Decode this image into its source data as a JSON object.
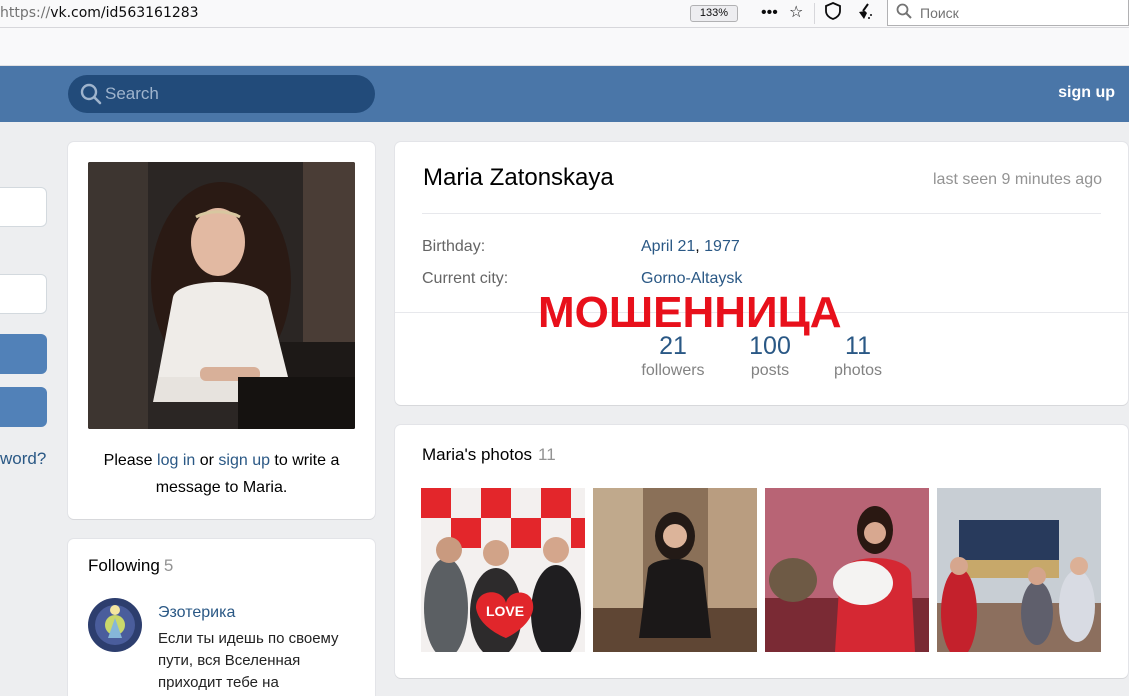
{
  "browser": {
    "url_scheme": "https://",
    "url_rest": "vk.com/id563161283",
    "zoom": "133%",
    "search_placeholder": "Поиск",
    "icons": [
      "menu-dots-icon",
      "star-icon",
      "shield-icon",
      "clean-icon",
      "search-icon"
    ]
  },
  "header": {
    "search_placeholder": "Search",
    "signup_label": "sign up",
    "color": "#4a76a8"
  },
  "left_login": {
    "forgot_fragment": "word?"
  },
  "profile": {
    "name": "Maria Zatonskaya",
    "last_seen": "last seen 9 minutes ago",
    "info": [
      {
        "label": "Birthday:",
        "value_date": "April 21",
        "value_sep": ", ",
        "value_year": "1977"
      },
      {
        "label": "Current city:",
        "value": "Gorno-Altaysk"
      }
    ],
    "counters": [
      {
        "num": "21",
        "label": "followers"
      },
      {
        "num": "100",
        "label": "posts"
      },
      {
        "num": "11",
        "label": "photos"
      }
    ]
  },
  "stamp_text": "МОШЕННИЦА",
  "avatar_card": {
    "msg_prefix": "Please ",
    "login_link": "log in",
    "msg_mid": " or ",
    "signup_link": "sign up",
    "msg_suffix": " to write a message to Maria."
  },
  "following": {
    "title": "Following",
    "count": "5",
    "group": {
      "name": "Эзотерика",
      "desc": "Если ты идешь по своему пути, вся Вселенная приходит тебе на"
    }
  },
  "photos": {
    "title": "Maria's photos",
    "count": "11"
  },
  "colors": {
    "link": "#2a5885",
    "stamp": "#e8101b",
    "page_bg": "#edeef0"
  }
}
